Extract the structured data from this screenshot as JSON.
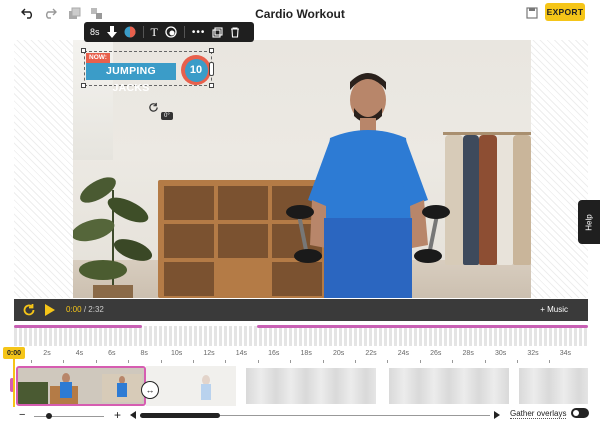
{
  "header": {
    "title": "Cardio Workout",
    "export_label": "EXPORT",
    "icons": [
      "undo-icon",
      "redo-icon",
      "duplicate-icon",
      "ungroup-icon",
      "save-icon"
    ]
  },
  "float_toolbar": {
    "duration": "8s",
    "icons": [
      "animation-icon",
      "color-icon",
      "text-icon",
      "style-icon",
      "more-icon",
      "copy-icon",
      "delete-icon"
    ]
  },
  "overlay": {
    "now_label": "NOW:",
    "exercise_label": "JUMPING JACKS",
    "count": "10",
    "rotation_label": "0°"
  },
  "help_label": "Help",
  "player": {
    "current_time": "0:00",
    "separator": "/",
    "total_time": "2:32",
    "music_label": "+ Music"
  },
  "timeline": {
    "playhead_time": "0:00",
    "ticks": [
      "2s",
      "4s",
      "6s",
      "8s",
      "10s",
      "12s",
      "14s",
      "16s",
      "18s",
      "20s",
      "22s",
      "24s",
      "26s",
      "28s",
      "30s",
      "32s",
      "34s"
    ]
  },
  "bottom": {
    "zoom_minus": "−",
    "zoom_plus": "+",
    "gather_label": "Gather overlays"
  },
  "colors": {
    "accent_yellow": "#f5c518",
    "overlay_red": "#e8604c",
    "overlay_blue": "#3b9cc8",
    "clip_pink": "#d65db1",
    "player_bg": "#3a3a3a"
  }
}
